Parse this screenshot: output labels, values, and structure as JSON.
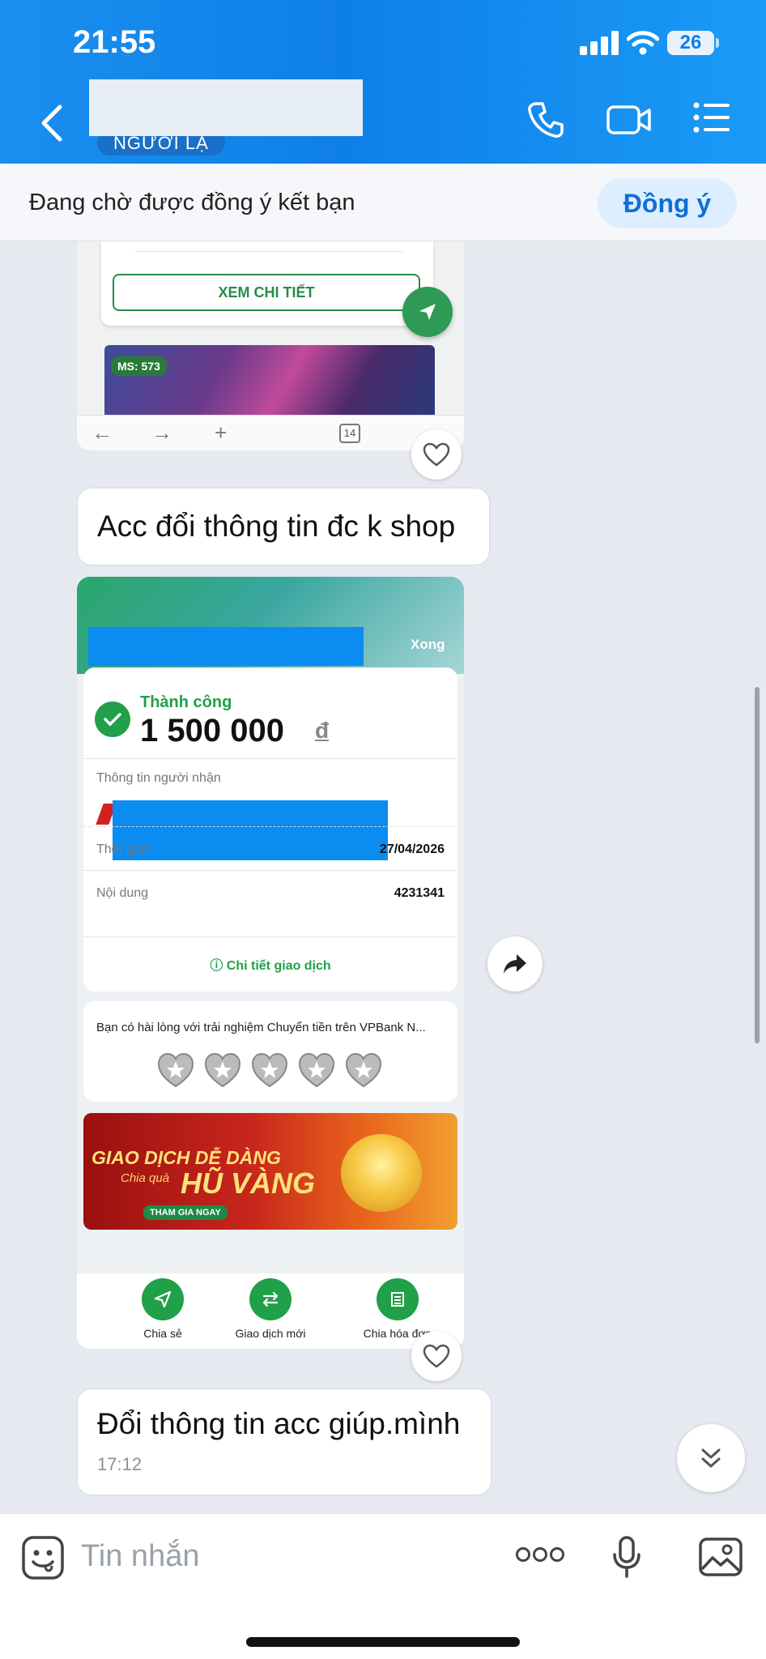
{
  "status_bar": {
    "time": "21:55",
    "battery": "26"
  },
  "header": {
    "stranger_badge": "NGƯỜI LẠ",
    "icons": [
      "back-icon",
      "phone-icon",
      "video-call-icon",
      "menu-list-icon"
    ]
  },
  "friend_request": {
    "text": "Đang chờ được đồng ý kết bạn",
    "accept_label": "Đồng ý"
  },
  "messages": [
    {
      "type": "image",
      "xem_chi_tiet": "XEM CHI TIẾT",
      "ms_badge": "MS: 573",
      "tabs_count": "14"
    },
    {
      "type": "text",
      "text": "Acc đổi thông tin đc k shop"
    },
    {
      "type": "image",
      "receipt": {
        "done_label": "Xong",
        "status": "Thành công",
        "amount": "1 500 000",
        "currency": "đ",
        "recipient_label": "Thông tin người nhận",
        "time_label": "Thời gian",
        "time_value": "27/04/2026",
        "content_label": "Nội dung",
        "content_value": "4231341",
        "detail_link": "Chi tiết giao dịch",
        "survey_question": "Bạn có hài lòng với trải nghiệm Chuyển tiền trên VPBank N...",
        "rating_stars": 5,
        "promo_line1": "GIAO DỊCH DỄ DÀNG",
        "promo_line2": "Chia quà",
        "promo_line3": "HŨ VÀNG",
        "promo_button": "THAM GIA NGAY",
        "actions": [
          "Chia sẻ",
          "Giao dịch mới",
          "Chia hóa đơn"
        ]
      }
    },
    {
      "type": "text",
      "text": "Đổi thông tin acc giúp.mình",
      "time": "17:12"
    }
  ],
  "input": {
    "placeholder": "Tin nhắn"
  },
  "colors": {
    "header_blue": "#0f7fe8",
    "accept_text": "#0f6fd6",
    "success_green": "#20a048"
  }
}
